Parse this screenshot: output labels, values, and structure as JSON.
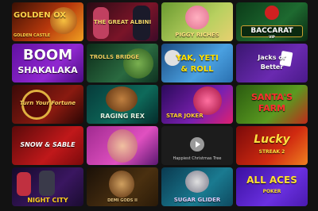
{
  "games": [
    {
      "title": "GOLDEN OX",
      "subtitle": "GOLDEN CASTLE",
      "bg": "linear-gradient(135deg,#3a1004,#b8380c 55%,#f0a020)",
      "color": "#ffd34a"
    },
    {
      "title": "THE GREAT ALBINI",
      "subtitle": "",
      "bg": "linear-gradient(135deg,#2a0a14,#7a1428 60%,#3b0b28)",
      "color": "#f4d96a"
    },
    {
      "title": "PIGGY RICHES",
      "subtitle": "",
      "bg": "linear-gradient(135deg,#6a9a30,#b8d060 60%,#e8d070)",
      "color": "#ffe080"
    },
    {
      "title": "BACCARAT",
      "subtitle": "VIP",
      "bg": "linear-gradient(135deg,#0b3b18,#1e6a30 60%,#0a2a12)",
      "color": "#ffffff"
    },
    {
      "title": "BOOM",
      "subtitle": "SHAKALAKA",
      "bg": "linear-gradient(135deg,#6010a0,#9028d0 60%,#4a0c80)",
      "color": "#ffffff"
    },
    {
      "title": "TROLLS BRIDGE",
      "subtitle": "",
      "bg": "linear-gradient(135deg,#0c2a18,#2a6a40 60%,#0e3020)",
      "color": "#f0d060"
    },
    {
      "title": "YAK, YETI",
      "subtitle": "& ROLL",
      "bg": "linear-gradient(135deg,#1a4a80,#4aa0e0 60%,#2a70b0)",
      "color": "#ffe000"
    },
    {
      "title": "Jacks or",
      "subtitle": "Better",
      "bg": "linear-gradient(135deg,#3a1670,#6a2ab0 60%,#4a1a8a)",
      "color": "#ffffff"
    },
    {
      "title": "Turn Your Fortune",
      "subtitle": "",
      "bg": "linear-gradient(135deg,#3a0a08,#8a1a10 60%,#2a0604)",
      "color": "#ffd060"
    },
    {
      "title": "RAGING REX",
      "subtitle": "",
      "bg": "linear-gradient(135deg,#063a3a,#0e6a5a 60%,#042a2a)",
      "color": "#e0f0e0"
    },
    {
      "title": "STAR JOKER",
      "subtitle": "",
      "bg": "linear-gradient(135deg,#2a0a5a,#7a20b0 60%,#e02070)",
      "color": "#ffd030"
    },
    {
      "title": "SANTA'S",
      "subtitle": "FARM",
      "bg": "linear-gradient(135deg,#2a5a10,#5a9a20 60%,#c02a1a)",
      "color": "#ff3030"
    },
    {
      "title": "SNOW & SABLE",
      "subtitle": "",
      "bg": "linear-gradient(135deg,#5a0a0a,#c0181a 60%,#7a0a0c)",
      "color": "#ffffff"
    },
    {
      "title": "",
      "subtitle": "",
      "bg": "linear-gradient(135deg,#a02a90,#e050c0 60%,#5a1870)",
      "color": "#ffffff"
    },
    {
      "title": "",
      "subtitle": "",
      "bg": "#1c1c1c",
      "color": "#ffffff",
      "caption": "Happiest Christmas Tree"
    },
    {
      "title": "Lucky",
      "subtitle": "STREAK 2",
      "bg": "linear-gradient(135deg,#7a0a0a,#d02a10 60%,#f08020)",
      "color": "#ffe040"
    },
    {
      "title": "NIGHT CITY",
      "subtitle": "",
      "bg": "linear-gradient(135deg,#140a2a,#3a1660 60%,#1a0c30)",
      "color": "#ffd020"
    },
    {
      "title": "DEMI GODS II",
      "subtitle": "",
      "bg": "linear-gradient(135deg,#1a1008,#4a3010 60%,#2a1a08)",
      "color": "#e0c080"
    },
    {
      "title": "SUGAR GLIDER",
      "subtitle": "",
      "bg": "linear-gradient(135deg,#0a3a50,#1a7a90 60%,#0e4a60)",
      "color": "#e0d0ff"
    },
    {
      "title": "ALL ACES",
      "subtitle": "POKER",
      "bg": "linear-gradient(135deg,#3a10a0,#6a30e0 60%,#4a1ab0)",
      "color": "#ffe030"
    }
  ]
}
